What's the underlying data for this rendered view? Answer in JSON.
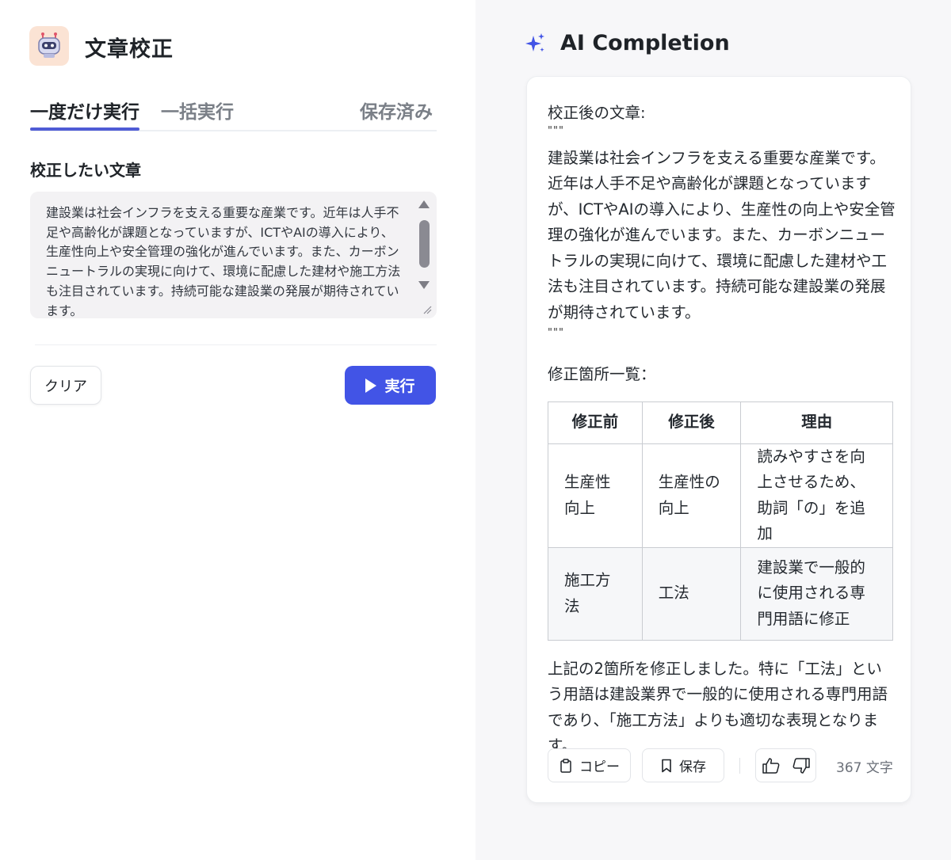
{
  "app": {
    "title": "文章校正",
    "icon": "robot-icon"
  },
  "tabs": [
    {
      "label": "一度だけ実行",
      "active": true
    },
    {
      "label": "一括実行",
      "active": false
    },
    {
      "label": "保存済み",
      "active": false
    }
  ],
  "input": {
    "label": "校正したい文章",
    "value": "建設業は社会インフラを支える重要な産業です。近年は人手不足や高齢化が課題となっていますが、ICTやAIの導入により、生産性向上や安全管理の強化が進んでいます。また、カーボンニュートラルの実現に向けて、環境に配慮した建材や施工方法も注目されています。持続可能な建設業の発展が期待されています。"
  },
  "actions": {
    "clear_label": "クリア",
    "run_label": "実行"
  },
  "completion": {
    "title": "AI Completion",
    "icon": "sparkle-icon",
    "heading_corrected": "校正後の文章:",
    "quote_open": "\"\"\"",
    "corrected_text": "建設業は社会インフラを支える重要な産業です。近年は人手不足や高齢化が課題となっていますが、ICTやAIの導入により、生産性の向上や安全管理の強化が進んでいます。また、カーボンニュートラルの実現に向けて、環境に配慮した建材や工法も注目されています。持続可能な建設業の発展が期待されています。",
    "quote_close": "\"\"\"",
    "heading_list": "修正箇所一覧：",
    "table": {
      "headers": [
        "修正前",
        "修正後",
        "理由"
      ],
      "rows": [
        [
          "生産性向上",
          "生産性の向上",
          "読みやすさを向上させるため、助詞「の」を追加"
        ],
        [
          "施工方法",
          "工法",
          "建設業で一般的に使用される専門用語に修正"
        ]
      ]
    },
    "summary": "上記の2箇所を修正しました。特に「工法」という用語は建設業界で一般的に使用される専門用語であり、「施工方法」よりも適切な表現となります。",
    "copy_label": "コピー",
    "save_label": "保存",
    "char_count": "367 文字"
  },
  "colors": {
    "accent": "#4254e6",
    "tab_underline": "#4f5bd5",
    "right_bg": "#f7f7f9"
  }
}
